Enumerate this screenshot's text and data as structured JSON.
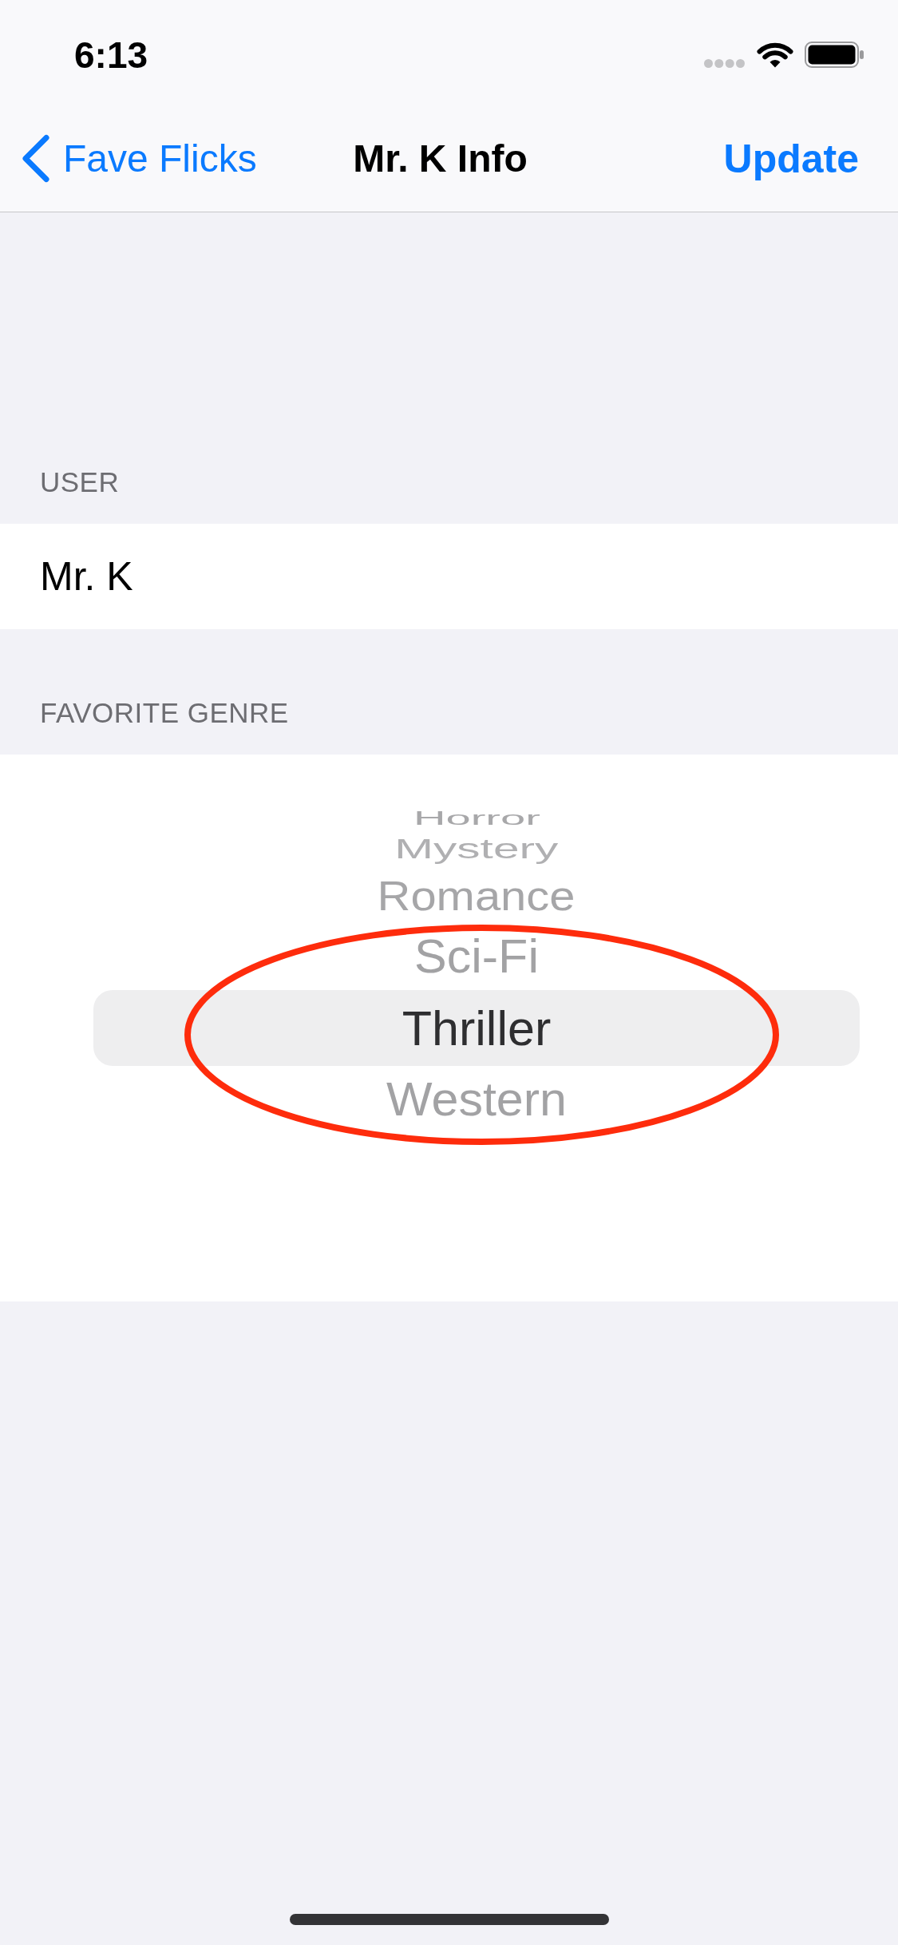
{
  "status_bar": {
    "time": "6:13"
  },
  "nav_bar": {
    "back_button": "Fave Flicks",
    "title": "Mr. K Info",
    "action_button": "Update"
  },
  "sections": [
    {
      "header": "USER",
      "kind": "text",
      "value": "Mr. K"
    },
    {
      "header": "FAVORITE GENRE",
      "kind": "picker",
      "options": [
        {
          "label": "Horror",
          "selected": false
        },
        {
          "label": "Mystery",
          "selected": false
        },
        {
          "label": "Romance",
          "selected": false
        },
        {
          "label": "Sci-Fi",
          "selected": false
        },
        {
          "label": "Thriller",
          "selected": true
        },
        {
          "label": "Western",
          "selected": false
        }
      ]
    }
  ]
}
